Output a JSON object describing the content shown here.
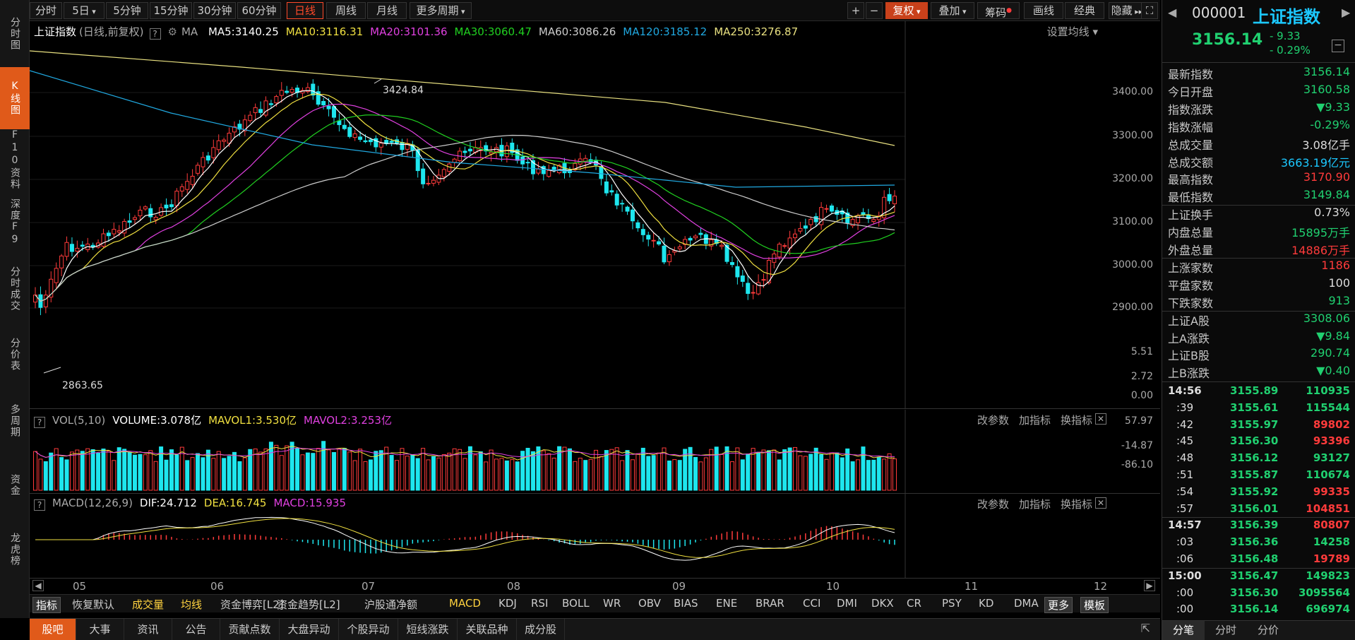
{
  "leftnav": [
    {
      "label": "分时图"
    },
    {
      "label": "K线图",
      "active": true
    },
    {
      "label": "F10资料"
    },
    {
      "label": "深度F9"
    },
    {
      "label": "分时成交"
    },
    {
      "label": "分价表"
    },
    {
      "label": "多周期"
    },
    {
      "label": "资金"
    },
    {
      "label": "龙虎榜"
    }
  ],
  "toolbar": {
    "periods": [
      "分时",
      "5日",
      "5分钟",
      "15分钟",
      "30分钟",
      "60分钟",
      "日线",
      "周线",
      "月线",
      "更多周期"
    ],
    "active_period": "日线",
    "right_buttons": [
      "复权",
      "叠加",
      "筹码",
      "画线",
      "经典",
      "隐藏"
    ]
  },
  "main_legend": {
    "name": "上证指数",
    "mode": "(日线,前复权)",
    "ma_label": "MA",
    "ma5": "MA5:3140.25",
    "ma10": "MA10:3116.31",
    "ma20": "MA20:3101.36",
    "ma30": "MA30:3060.47",
    "ma60": "MA60:3086.26",
    "ma120": "MA120:3185.12",
    "ma250": "MA250:3276.87",
    "settings": "设置均线"
  },
  "vol_legend": {
    "name": "VOL(5,10)",
    "volume": "VOLUME:3.078亿",
    "mavol1": "MAVOL1:3.530亿",
    "mavol2": "MAVOL2:3.253亿"
  },
  "macd_legend": {
    "name": "MACD(12,26,9)",
    "dif": "DIF:24.712",
    "dea": "DEA:16.745",
    "macd": "MACD:15.935"
  },
  "panel_links": [
    "改参数",
    "加指标",
    "换指标"
  ],
  "price_axis": [
    "3400.00",
    "3300.00",
    "3200.00",
    "3100.00",
    "3000.00",
    "2900.00"
  ],
  "vol_axis": [
    "5.51",
    "2.72",
    "0.00"
  ],
  "macd_axis": [
    "57.97",
    "-14.87",
    "-86.10"
  ],
  "annotations": {
    "high": "3424.84",
    "low": "2863.65"
  },
  "date_axis": [
    "05",
    "06",
    "07",
    "08",
    "09",
    "10",
    "11",
    "12"
  ],
  "indicators": [
    "指标",
    "恢复默认",
    "成交量",
    "均线",
    "资金博弈[L2]",
    "资金趋势[L2]",
    "沪股通净额",
    "MACD",
    "KDJ",
    "RSI",
    "BOLL",
    "WR",
    "OBV",
    "BIAS",
    "ENE",
    "BRAR",
    "CCI",
    "DMI",
    "DKX",
    "CR",
    "PSY",
    "KD",
    "DMA",
    "更多",
    "模板"
  ],
  "bottom_tabs": [
    "股吧",
    "大事",
    "资讯",
    "公告",
    "贡献点数",
    "大盘异动",
    "个股异动",
    "短线涨跌",
    "关联品种",
    "成分股"
  ],
  "sidebar": {
    "code": "000001",
    "name": "上证指数",
    "price": "3156.14",
    "change": "- 9.33",
    "change_pct": "- 0.29%",
    "stats": [
      {
        "k": "最新指数",
        "v": "3156.14",
        "c": "green"
      },
      {
        "k": "今日开盘",
        "v": "3160.58",
        "c": "green"
      },
      {
        "k": "指数涨跌",
        "v": "▼9.33",
        "c": "green"
      },
      {
        "k": "指数涨幅",
        "v": "-0.29%",
        "c": "green"
      },
      {
        "k": "总成交量",
        "v": "3.08亿手",
        "c": "white"
      },
      {
        "k": "总成交额",
        "v": "3663.19亿元",
        "c": "cyan"
      },
      {
        "k": "最高指数",
        "v": "3170.90",
        "c": "red"
      },
      {
        "k": "最低指数",
        "v": "3149.84",
        "c": "green"
      },
      {
        "k": "上证换手",
        "v": "0.73%",
        "c": "white"
      },
      {
        "k": "内盘总量",
        "v": "15895万手",
        "c": "green"
      },
      {
        "k": "外盘总量",
        "v": "14886万手",
        "c": "red"
      },
      {
        "k": "上涨家数",
        "v": "1186",
        "c": "red"
      },
      {
        "k": "平盘家数",
        "v": "100",
        "c": "white"
      },
      {
        "k": "下跌家数",
        "v": "913",
        "c": "green"
      },
      {
        "k": "上证A股",
        "v": "3308.06",
        "c": "green"
      },
      {
        "k": "上A涨跌",
        "v": "▼9.84",
        "c": "green"
      },
      {
        "k": "上证B股",
        "v": "290.74",
        "c": "green"
      },
      {
        "k": "上B涨跌",
        "v": "▼0.40",
        "c": "green"
      }
    ],
    "ticks": [
      {
        "t": "14:56",
        "p": "3155.89",
        "q": "110935",
        "qc": "green",
        "bold": true
      },
      {
        "t": ":39",
        "p": "3155.61",
        "q": "115544",
        "qc": "green"
      },
      {
        "t": ":42",
        "p": "3155.97",
        "q": "89802",
        "qc": "red"
      },
      {
        "t": ":45",
        "p": "3156.30",
        "q": "93396",
        "qc": "red"
      },
      {
        "t": ":48",
        "p": "3156.12",
        "q": "93127",
        "qc": "green"
      },
      {
        "t": ":51",
        "p": "3155.87",
        "q": "110674",
        "qc": "green"
      },
      {
        "t": ":54",
        "p": "3155.92",
        "q": "99335",
        "qc": "red"
      },
      {
        "t": ":57",
        "p": "3156.01",
        "q": "104851",
        "qc": "red"
      },
      {
        "t": "14:57",
        "p": "3156.39",
        "q": "80807",
        "qc": "red",
        "bold": true
      },
      {
        "t": ":03",
        "p": "3156.36",
        "q": "14258",
        "qc": "green"
      },
      {
        "t": ":06",
        "p": "3156.48",
        "q": "19789",
        "qc": "red"
      },
      {
        "t": "15:00",
        "p": "3156.47",
        "q": "149823",
        "qc": "green",
        "bold": true
      },
      {
        "t": ":00",
        "p": "3156.30",
        "q": "3095564",
        "qc": "green"
      },
      {
        "t": ":00",
        "p": "3156.14",
        "q": "696974",
        "qc": "green"
      }
    ],
    "tabs": [
      "分笔",
      "分时",
      "分价"
    ]
  },
  "colors": {
    "up": "#ff3b3b",
    "down": "#1ee6ee",
    "ma5": "#ffffff",
    "ma10": "#f0e040",
    "ma20": "#e040e0",
    "ma30": "#20d020",
    "ma60": "#cccccc",
    "ma120": "#20a8e0",
    "ma250": "#e8e080",
    "accent": "#e05a1a"
  }
}
